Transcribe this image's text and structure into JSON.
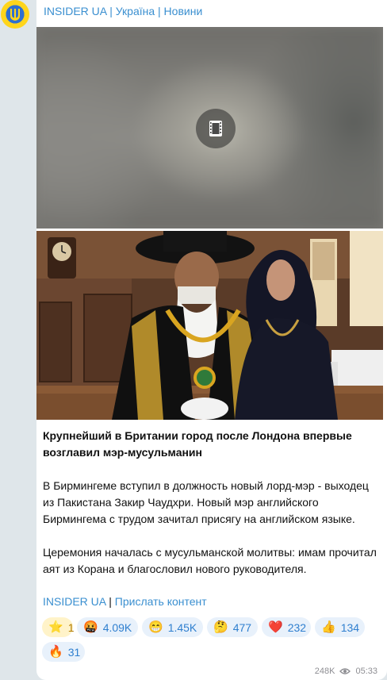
{
  "channel": {
    "name": "INSIDER UA | Україна | Новини"
  },
  "post": {
    "media": [
      {
        "kind": "video",
        "icon": "film-icon"
      },
      {
        "kind": "photo"
      }
    ],
    "headline": "Крупнейший в Британии город после Лондона впервые возглавил мэр-мусульманин",
    "paragraph1": "В Бирмингеме вступил в должность новый лорд-мэр - выходец из Пакистана Закир Чаудхри. Новый мэр английского Бирмингема с трудом зачитал присягу на английском языке.",
    "paragraph2": "Церемония началась с мусульманской молитвы: имам прочитал аят из Корана и благословил нового руководителя.",
    "link1": "INSIDER UA",
    "separator": "|",
    "link2": "Прислать контент"
  },
  "reactions": [
    {
      "emoji": "⭐",
      "icon": "star-icon",
      "count": "1"
    },
    {
      "emoji": "🤬",
      "icon": "angry-face-icon",
      "count": "4.09K"
    },
    {
      "emoji": "😁",
      "icon": "grin-face-icon",
      "count": "1.45K"
    },
    {
      "emoji": "🤔",
      "icon": "thinking-face-icon",
      "count": "477"
    },
    {
      "emoji": "❤️",
      "icon": "heart-icon",
      "count": "232"
    },
    {
      "emoji": "👍",
      "icon": "thumbs-up-icon",
      "count": "134"
    },
    {
      "emoji": "🔥",
      "icon": "fire-icon",
      "count": "31"
    }
  ],
  "meta": {
    "views": "248K",
    "time": "05:33"
  },
  "colors": {
    "accent": "#3a8fd0",
    "chat_background": "#dfe6ea",
    "paid_reaction": "#fff3c9",
    "reaction": "#e8f1fb"
  }
}
